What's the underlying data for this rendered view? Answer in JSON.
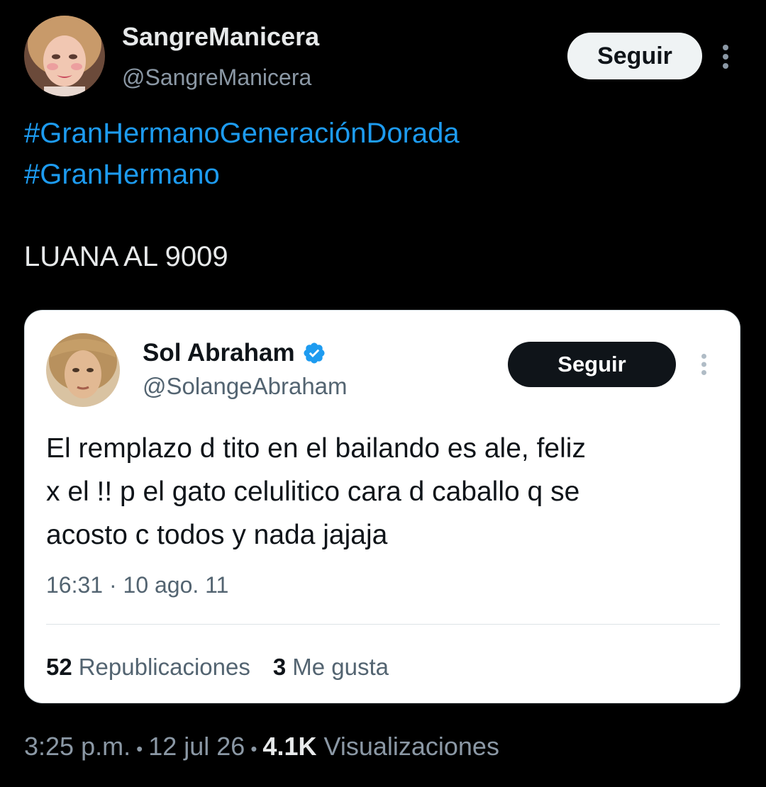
{
  "author": {
    "name": "SangreManicera",
    "handle": "@SangreManicera",
    "follow_label": "Seguir",
    "avatar_icon": "avatar-photo-icon",
    "more_icon": "more-vertical-icon"
  },
  "tweet": {
    "hashtags": [
      "#GranHermanoGeneraciónDorada",
      "#GranHermano"
    ],
    "text": "LUANA AL 9009"
  },
  "quoted": {
    "name": "Sol Abraham",
    "verified_icon": "verified-badge-icon",
    "handle": "@SolangeAbraham",
    "follow_label": "Seguir",
    "more_icon": "more-vertical-icon",
    "text_lines": [
      "El remplazo d tito en el bailando es ale, feliz",
      "x el !! p el gato celulitico cara d caballo q se",
      "acosto c todos y nada jajaja"
    ],
    "meta": "16:31 · 10 ago. 11",
    "stats": {
      "reposts_count": "52",
      "reposts_label": "Republicaciones",
      "likes_count": "3",
      "likes_label": "Me gusta"
    }
  },
  "footer": {
    "time": "3:25 p.m.",
    "separator": "•",
    "date": "12 jul 26",
    "views_count": "4.1K",
    "views_label": "Visualizaciones"
  },
  "colors": {
    "background": "#000000",
    "link": "#1d9bf0",
    "primary_text": "#e7e9ea",
    "secondary_text": "#8b98a5",
    "card_background": "#ffffff",
    "verified": "#1d9bf0"
  }
}
